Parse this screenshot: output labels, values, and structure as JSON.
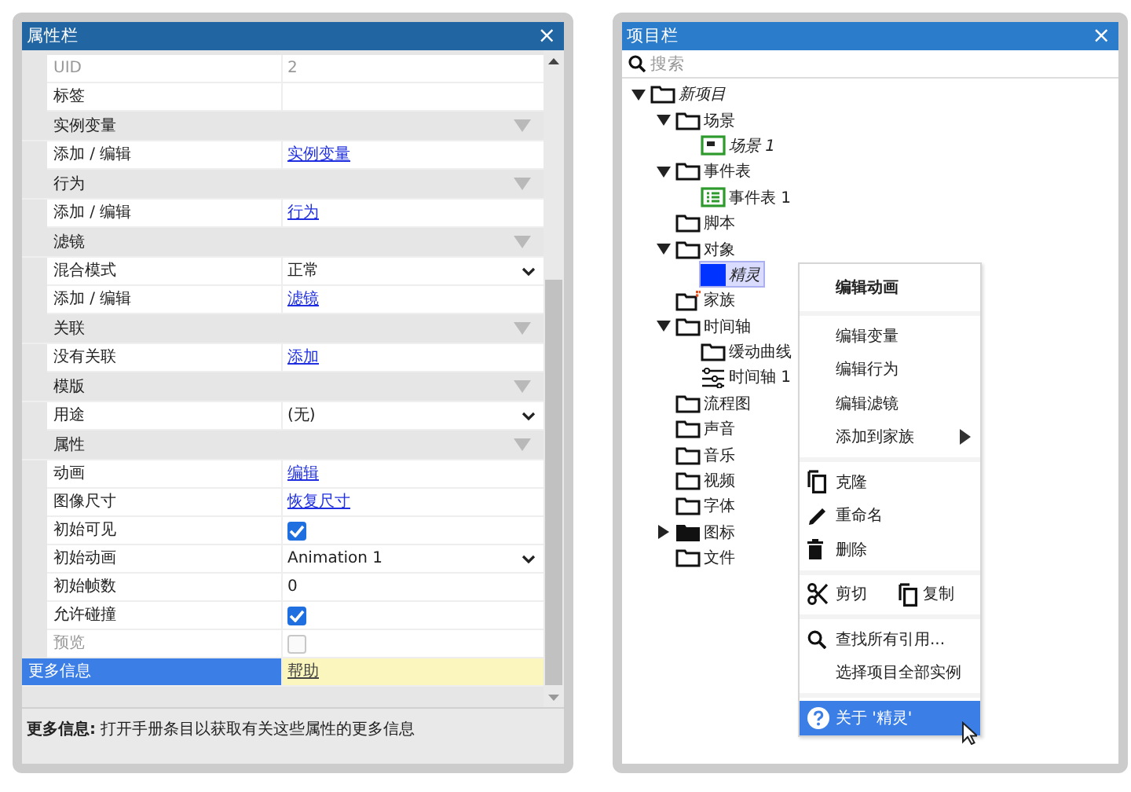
{
  "properties_panel": {
    "title": "属性栏",
    "close": "×",
    "rows": [
      {
        "kind": "text",
        "name": "UID",
        "value": "2",
        "disabled": true,
        "selected": false
      },
      {
        "kind": "text",
        "name": "标签",
        "value": "",
        "disabled": false,
        "selected": false
      },
      {
        "kind": "section",
        "name": "实例变量",
        "expanded": true
      },
      {
        "kind": "link",
        "name": "添加 / 编辑",
        "value": "实例变量",
        "disabled": false,
        "selected": false
      },
      {
        "kind": "section",
        "name": "行为",
        "expanded": true
      },
      {
        "kind": "link",
        "name": "添加 / 编辑",
        "value": "行为",
        "disabled": false,
        "selected": false
      },
      {
        "kind": "section",
        "name": "滤镜",
        "expanded": true
      },
      {
        "kind": "select",
        "name": "混合模式",
        "value": "正常",
        "disabled": false,
        "selected": false
      },
      {
        "kind": "link",
        "name": "添加 / 编辑",
        "value": "滤镜",
        "disabled": false,
        "selected": false
      },
      {
        "kind": "section",
        "name": "关联",
        "expanded": true
      },
      {
        "kind": "link",
        "name": "没有关联",
        "value": "添加",
        "disabled": false,
        "selected": false
      },
      {
        "kind": "section",
        "name": "模版",
        "expanded": true
      },
      {
        "kind": "select",
        "name": "用途",
        "value": "(无)",
        "disabled": false,
        "selected": false
      },
      {
        "kind": "section",
        "name": "属性",
        "expanded": true
      },
      {
        "kind": "link",
        "name": "动画",
        "value": "编辑",
        "disabled": false,
        "selected": false
      },
      {
        "kind": "link",
        "name": "图像尺寸",
        "value": "恢复尺寸",
        "disabled": false,
        "selected": false
      },
      {
        "kind": "checkbox",
        "name": "初始可见",
        "checked": true,
        "disabled": false,
        "selected": false
      },
      {
        "kind": "select",
        "name": "初始动画",
        "value": "Animation 1",
        "disabled": false,
        "selected": false
      },
      {
        "kind": "text",
        "name": "初始帧数",
        "value": "0",
        "disabled": false,
        "selected": false
      },
      {
        "kind": "checkbox",
        "name": "允许碰撞",
        "checked": true,
        "disabled": false,
        "selected": false
      },
      {
        "kind": "checkbox",
        "name": "预览",
        "checked": false,
        "disabled": true,
        "selected": false
      },
      {
        "kind": "link",
        "name": "更多信息",
        "value": "帮助",
        "disabled": false,
        "selected": true
      }
    ],
    "description": "**更多信息:** 打开手册条目以获取有关这些属性的更多信息"
  },
  "project_panel": {
    "title": "项目栏",
    "close": "×",
    "search": {
      "placeholder": "搜索"
    },
    "tree": [
      {
        "label": "新项目",
        "kind": "folder",
        "italic": true,
        "expanded": true,
        "selected": false,
        "children": [
          {
            "label": "场景",
            "kind": "folder",
            "italic": false,
            "expanded": true,
            "selected": false,
            "children": [
              {
                "label": "场景 1",
                "kind": "layout",
                "italic": true,
                "selected": false
              }
            ]
          },
          {
            "label": "事件表",
            "kind": "folder",
            "italic": false,
            "expanded": true,
            "selected": false,
            "children": [
              {
                "label": "事件表 1",
                "kind": "sheet",
                "italic": false,
                "selected": false
              }
            ]
          },
          {
            "label": "脚本",
            "kind": "folder",
            "italic": false,
            "selected": false
          },
          {
            "label": "对象",
            "kind": "folder",
            "italic": false,
            "expanded": true,
            "selected": false,
            "children": [
              {
                "label": "精灵",
                "kind": "sprite",
                "italic": true,
                "selected": true
              }
            ]
          },
          {
            "label": "家族",
            "kind": "family",
            "italic": false,
            "selected": false
          },
          {
            "label": "时间轴",
            "kind": "folder",
            "italic": false,
            "expanded": true,
            "selected": false,
            "children": [
              {
                "label": "缓动曲线",
                "kind": "folder",
                "italic": false,
                "selected": false
              },
              {
                "label": "时间轴 1",
                "kind": "timeline",
                "italic": false,
                "selected": false
              }
            ]
          },
          {
            "label": "流程图",
            "kind": "folder",
            "italic": false,
            "selected": false
          },
          {
            "label": "声音",
            "kind": "folder",
            "italic": false,
            "selected": false
          },
          {
            "label": "音乐",
            "kind": "folder",
            "italic": false,
            "selected": false
          },
          {
            "label": "视频",
            "kind": "folder",
            "italic": false,
            "selected": false
          },
          {
            "label": "字体",
            "kind": "folder",
            "italic": false,
            "selected": false
          },
          {
            "label": "图标",
            "kind": "folder-filled",
            "italic": false,
            "expanded": false,
            "selected": false
          },
          {
            "label": "文件",
            "kind": "folder",
            "italic": false,
            "selected": false
          }
        ]
      }
    ]
  },
  "context_menu": {
    "groups": [
      {
        "kind": "list",
        "items": [
          {
            "label": "编辑动画",
            "kind": "plain",
            "bold": true,
            "submenu": false,
            "selected": false
          }
        ]
      },
      {
        "kind": "list",
        "items": [
          {
            "label": "编辑变量",
            "kind": "plain",
            "bold": false,
            "submenu": false,
            "selected": false
          },
          {
            "label": "编辑行为",
            "kind": "plain",
            "bold": false,
            "submenu": false,
            "selected": false
          },
          {
            "label": "编辑滤镜",
            "kind": "plain",
            "bold": false,
            "submenu": false,
            "selected": false
          },
          {
            "label": "添加到家族",
            "kind": "plain",
            "bold": false,
            "submenu": true,
            "selected": false
          }
        ]
      },
      {
        "kind": "list",
        "items": [
          {
            "label": "克隆",
            "kind": "copy",
            "bold": false,
            "submenu": false,
            "selected": false
          },
          {
            "label": "重命名",
            "kind": "pencil",
            "bold": false,
            "submenu": false,
            "selected": false
          },
          {
            "label": "删除",
            "kind": "trash",
            "bold": false,
            "submenu": false,
            "selected": false
          }
        ]
      },
      {
        "kind": "row",
        "items": [
          {
            "label": "剪切",
            "kind": "scissors",
            "bold": false,
            "submenu": false,
            "selected": false
          },
          {
            "label": "复制",
            "kind": "copy",
            "bold": false,
            "submenu": false,
            "selected": false
          }
        ]
      },
      {
        "kind": "list",
        "items": [
          {
            "label": "查找所有引用...",
            "kind": "search",
            "bold": false,
            "submenu": false,
            "selected": false
          },
          {
            "label": "选择项目全部实例",
            "kind": "plain",
            "bold": false,
            "submenu": false,
            "selected": false
          }
        ]
      },
      {
        "kind": "list",
        "items": [
          {
            "label": "关于 '精灵'",
            "kind": "help",
            "bold": false,
            "submenu": false,
            "selected": true
          }
        ]
      }
    ]
  }
}
